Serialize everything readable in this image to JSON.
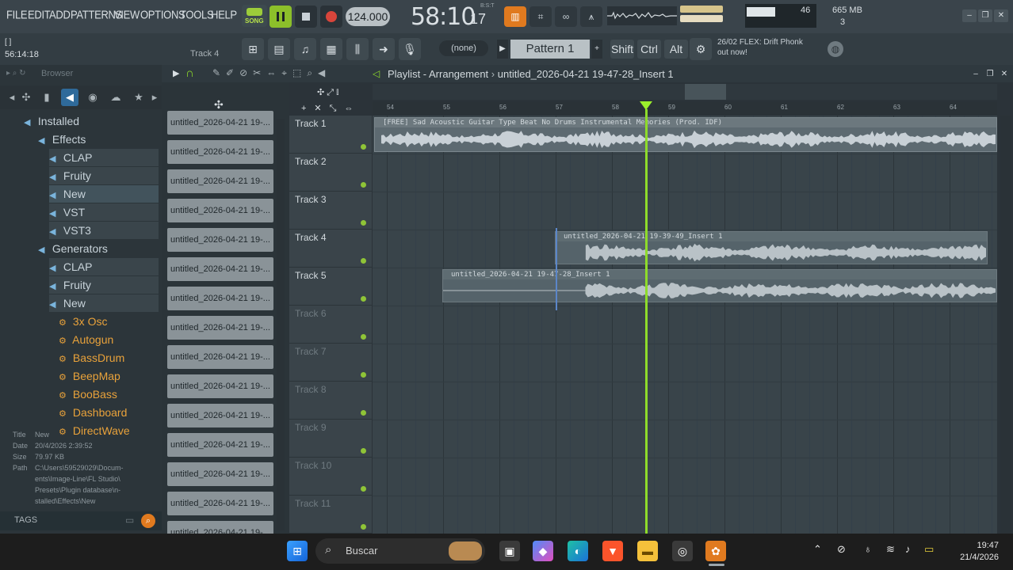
{
  "menu": [
    "FILE",
    "EDIT",
    "ADD",
    "PATTERNS",
    "VIEW",
    "OPTIONS",
    "TOOLS",
    "HELP"
  ],
  "transport": {
    "mode_label": "SONG",
    "tempo": "124.000",
    "time_main": "58:10",
    "time_sub": "17",
    "time_unit": "B:S:T"
  },
  "cpu": {
    "value": "46",
    "memory": "665 MB",
    "poly": "3"
  },
  "toolbar": {
    "hint_text": "[ ]",
    "time_position": "56:14:18",
    "track_hint": "Track 4",
    "pattern_none": "(none)",
    "pattern_name": "Pattern 1",
    "modifiers": [
      "Shift",
      "Ctrl",
      "Alt"
    ],
    "news_date": "26/02",
    "news_line1": "FLEX: Drift Phonk",
    "news_line2": "out now!"
  },
  "browser": {
    "title": "Browser",
    "tree": [
      {
        "label": "Installed",
        "level": 0,
        "kind": "folder"
      },
      {
        "label": "Effects",
        "level": 1,
        "kind": "folder"
      },
      {
        "label": "CLAP",
        "level": 2,
        "kind": "folder"
      },
      {
        "label": "Fruity",
        "level": 2,
        "kind": "folder"
      },
      {
        "label": "New",
        "level": 2,
        "kind": "folder-selected"
      },
      {
        "label": "VST",
        "level": 2,
        "kind": "folder"
      },
      {
        "label": "VST3",
        "level": 2,
        "kind": "folder"
      },
      {
        "label": "Generators",
        "level": 1,
        "kind": "folder"
      },
      {
        "label": "CLAP",
        "level": 2,
        "kind": "folder"
      },
      {
        "label": "Fruity",
        "level": 2,
        "kind": "folder"
      },
      {
        "label": "New",
        "level": 2,
        "kind": "folder"
      },
      {
        "label": "3x Osc",
        "level": 3,
        "kind": "gen"
      },
      {
        "label": "Autogun",
        "level": 3,
        "kind": "gen"
      },
      {
        "label": "BassDrum",
        "level": 3,
        "kind": "gen"
      },
      {
        "label": "BeepMap",
        "level": 3,
        "kind": "gen"
      },
      {
        "label": "BooBass",
        "level": 3,
        "kind": "gen"
      },
      {
        "label": "Dashboard",
        "level": 3,
        "kind": "gen"
      },
      {
        "label": "DirectWave",
        "level": 3,
        "kind": "gen"
      }
    ],
    "info": {
      "title_label": "Title",
      "title": "New",
      "date_label": "Date",
      "date": "20/4/2026 2:39:52",
      "size_label": "Size",
      "size": "79.97 KB",
      "path_label": "Path",
      "path_lines": [
        "C:\\Users\\59529029\\Docum-",
        "ents\\Image-Line\\FL Studio\\",
        "Presets\\Plugin database\\n-",
        "stalled\\Effects\\New"
      ]
    },
    "tags_label": "TAGS"
  },
  "playlist": {
    "title": "Playlist - Arrangement",
    "breadcrumb": "untitled_2026-04-21 19-47-28_Insert 1",
    "clip_list": [
      "untitled_2026-04-21 19-...",
      "untitled_2026-04-21 19-...",
      "untitled_2026-04-21 19-...",
      "untitled_2026-04-21 19-...",
      "untitled_2026-04-21 19-...",
      "untitled_2026-04-21 19-...",
      "untitled_2026-04-21 19-...",
      "untitled_2026-04-21 19-...",
      "untitled_2026-04-21 19-...",
      "untitled_2026-04-21 19-...",
      "untitled_2026-04-21 19-...",
      "untitled_2026-04-21 19-...",
      "untitled_2026-04-21 19-...",
      "untitled_2026-04-21 19-...",
      "untitled_2026-04-21 19-..."
    ],
    "bars": [
      "54",
      "55",
      "56",
      "57",
      "58",
      "59",
      "60",
      "61",
      "62",
      "63",
      "64"
    ],
    "tracks": [
      "Track 1",
      "Track 2",
      "Track 3",
      "Track 4",
      "Track 5",
      "Track 6",
      "Track 7",
      "Track 8",
      "Track 9",
      "Track 10",
      "Track 11"
    ],
    "clips": {
      "track1": "[FREE] Sad Acoustic Guitar Type Beat No Drums Instrumental  Memories (Prod. IDF)",
      "track4": "untitled_2026-04-21 19-39-49_Insert 1",
      "track5": "untitled_2026-04-21 19-47-28_Insert 1"
    }
  },
  "taskbar": {
    "search_label": "Buscar",
    "time": "19:47",
    "date": "21/4/2026"
  }
}
